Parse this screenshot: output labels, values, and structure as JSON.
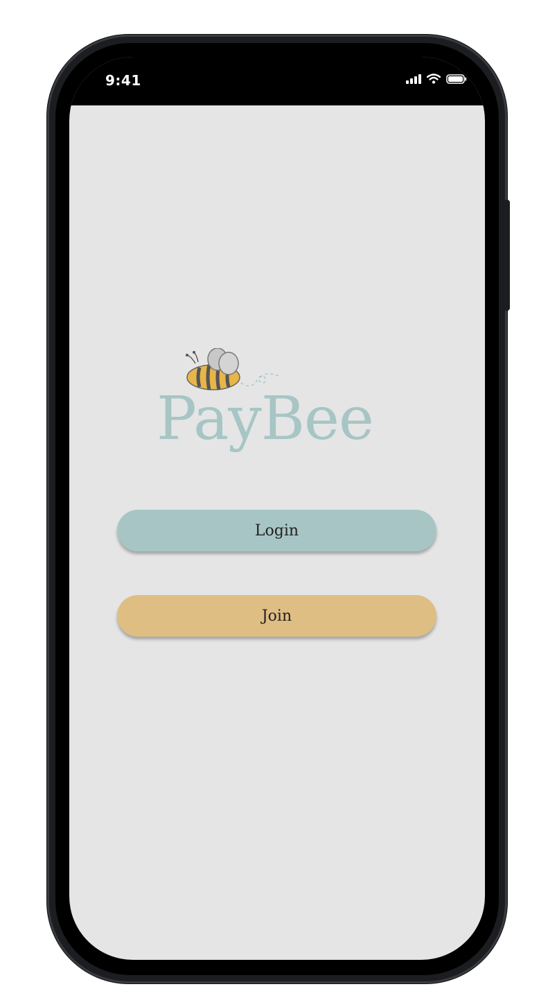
{
  "status_bar": {
    "time": "9:41",
    "icons": [
      "signal-icon",
      "wifi-icon",
      "battery-icon"
    ]
  },
  "logo": {
    "text": "PayBee",
    "icon": "bee-icon"
  },
  "buttons": {
    "login_label": "Login",
    "join_label": "Join"
  },
  "colors": {
    "screen_background": "#e5e5e5",
    "brand_teal": "#a7c5c5",
    "brand_gold": "#dfbe84",
    "bee_body": "#e8b54a",
    "bee_stripes": "#555555",
    "wings": "#c8c8c8"
  }
}
